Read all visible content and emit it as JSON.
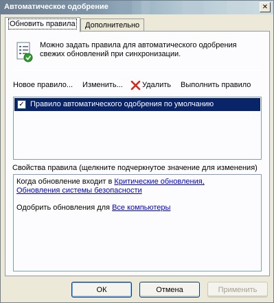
{
  "window": {
    "title": "Автоматическое одобрение",
    "close_glyph": "✕"
  },
  "tabs": [
    {
      "label": "Обновить правила",
      "active": true
    },
    {
      "label": "Дополнительно",
      "active": false
    }
  ],
  "intro": {
    "icon": "document-checklist-icon",
    "text": "Можно задать правила для автоматического одобрения свежих обновлений при синхронизации."
  },
  "toolbar": {
    "new_rule": "Новое правило...",
    "edit": "Изменить...",
    "delete": "Удалить",
    "run": "Выполнить правило"
  },
  "rules": [
    {
      "label": "Правило автоматического одобрения по умолчанию",
      "checked": true,
      "selected": true
    }
  ],
  "properties": {
    "header": "Свойства правила (щелкните подчеркнутое значение для изменения)",
    "line1_prefix": "Когда обновление входит в ",
    "line1_link_a": "Критические обновления,",
    "line1_link_b": "Обновления системы безопасности",
    "line2_prefix": "Одобрить обновления для ",
    "line2_link": "Все компьютеры"
  },
  "buttons": {
    "ok": "ОК",
    "cancel": "Отмена",
    "apply": "Применить"
  },
  "colors": {
    "selection": "#0a246a",
    "link": "#0000cc",
    "delete_icon": "#d12a1a"
  }
}
